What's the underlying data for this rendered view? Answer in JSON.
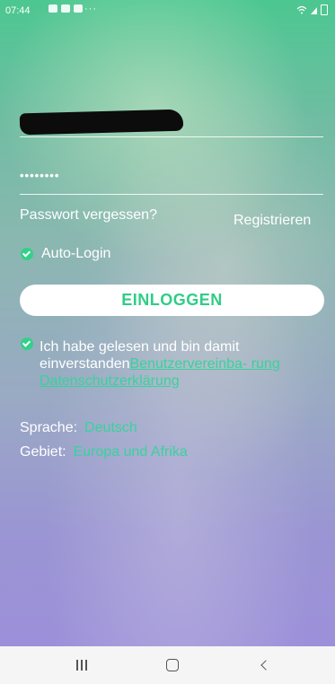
{
  "status_bar": {
    "time": "07:44",
    "notification_icons": [
      "gallery-icon",
      "message-icon",
      "image-icon"
    ],
    "overflow": "···",
    "right_icons": [
      "wifi-icon",
      "signal-icon",
      "battery-icon"
    ]
  },
  "form": {
    "username_value": "",
    "password_value": "••••••••"
  },
  "links": {
    "forgot_password": "Passwort vergessen?",
    "register": "Registrieren"
  },
  "auto_login": {
    "label": "Auto-Login",
    "checked": true
  },
  "login_button": {
    "label": "EINLOGGEN",
    "color": "#2fcd86"
  },
  "agreement": {
    "checked": true,
    "text_prefix": "Ich habe gelesen und bin damit einverstanden",
    "link_user_agreement": "Benutzervereinba- rung",
    "link_privacy": "Datenschutzerklärung"
  },
  "settings": {
    "language_label": "Sprache:",
    "language_value": "Deutsch",
    "region_label": "Gebiet:",
    "region_value": "Europa und Afrika"
  },
  "nav_bar": {
    "buttons": [
      "recents",
      "home",
      "back"
    ]
  },
  "colors": {
    "accent": "#37d39b",
    "top_gradient": "#4cc791",
    "bottom_gradient": "#9c90da"
  }
}
